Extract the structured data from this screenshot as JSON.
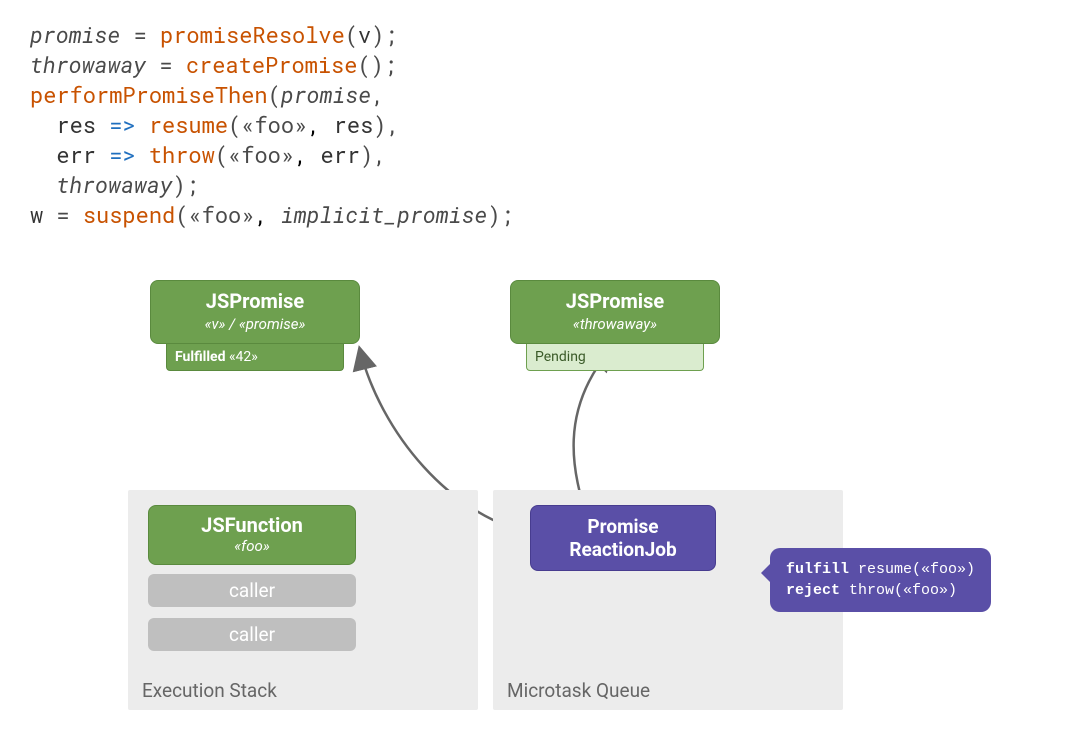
{
  "code": {
    "l1": {
      "a": "promise",
      "op": " = ",
      "fn": "promiseResolve",
      "p1": "(",
      "arg": "v",
      "p2": ");"
    },
    "l2": {
      "a": "throwaway",
      "op": " = ",
      "fn": "createPromise",
      "p": "();"
    },
    "l3": {
      "fn": "performPromiseThen",
      "p1": "(",
      "arg": "promise",
      "p2": ","
    },
    "l4": {
      "indent": "  ",
      "var": "res",
      "arrow": " => ",
      "fn": "resume",
      "p1": "(",
      "s": "«foo»",
      "c": ", ",
      "var2": "res",
      "p2": "),"
    },
    "l5": {
      "indent": "  ",
      "var": "err",
      "arrow": " => ",
      "fn": "throw",
      "p1": "(",
      "s": "«foo»",
      "c": ", ",
      "var2": "err",
      "p2": "),"
    },
    "l6": {
      "indent": "  ",
      "arg": "throwaway",
      "p": ");"
    },
    "l7": {
      "var": "w",
      "op": " = ",
      "fn": "suspend",
      "p1": "(",
      "s": "«foo»",
      "c": ", ",
      "arg": "implicit_promise",
      "p2": ");"
    }
  },
  "promise1": {
    "title": "JSPromise",
    "sub": "«v» / «promise»",
    "status_label": "Fulfilled",
    "status_val": " «42»"
  },
  "promise2": {
    "title": "JSPromise",
    "sub": "«throwaway»",
    "status_label": "Pending"
  },
  "jsfunction": {
    "title": "JSFunction",
    "sub": "«foo»"
  },
  "callers": [
    "caller",
    "caller"
  ],
  "reactionjob": {
    "l1": "Promise",
    "l2": "ReactionJob"
  },
  "speech": {
    "r1k": "fulfill",
    "r1v": " resume(«foo»)",
    "r2k": "reject",
    "r2v": "  throw(«foo»)"
  },
  "panels": {
    "exec": "Execution Stack",
    "micro": "Microtask Queue"
  }
}
